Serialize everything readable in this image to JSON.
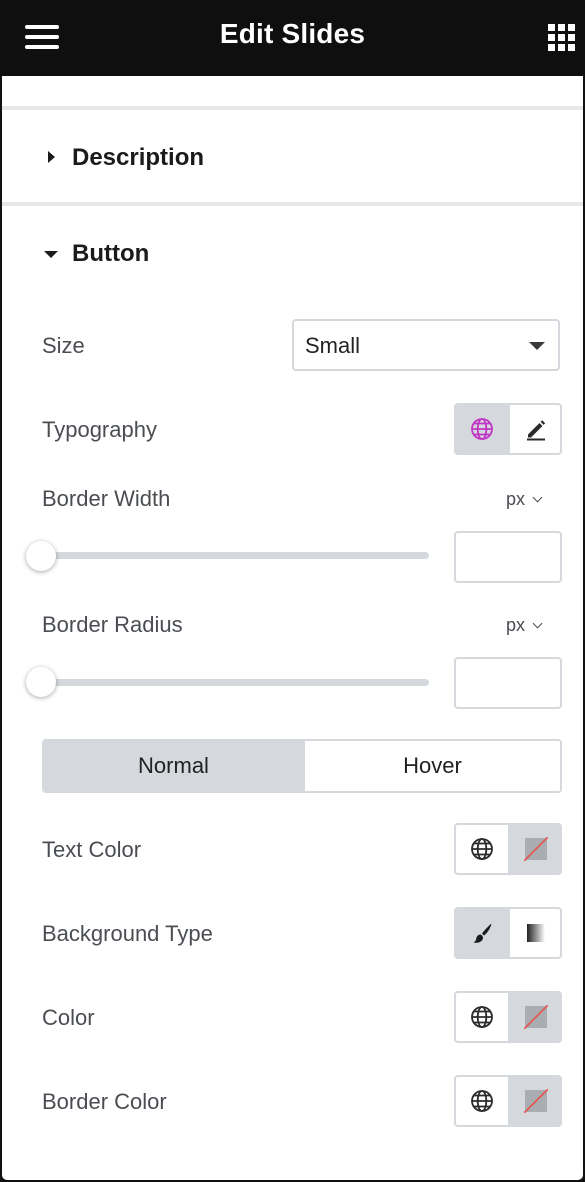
{
  "header": {
    "title": "Edit Slides",
    "menu_icon": "hamburger-menu-icon",
    "widgets_icon": "grid-icon"
  },
  "sections": {
    "description": {
      "label": "Description",
      "expanded": false
    },
    "button": {
      "label": "Button",
      "expanded": true
    }
  },
  "controls": {
    "size": {
      "label": "Size",
      "value": "Small"
    },
    "typography": {
      "label": "Typography",
      "icons": [
        "globe-icon",
        "pencil-icon"
      ],
      "accent": "#c036c5"
    },
    "border_width": {
      "label": "Border Width",
      "unit": "px",
      "value": ""
    },
    "border_radius": {
      "label": "Border Radius",
      "unit": "px",
      "value": ""
    },
    "state_tabs": {
      "items": [
        "Normal",
        "Hover"
      ],
      "active": "Normal"
    },
    "text_color": {
      "label": "Text Color",
      "icons": [
        "globe-icon",
        "no-color-swatch-icon"
      ]
    },
    "background_type": {
      "label": "Background Type",
      "icons": [
        "brush-icon",
        "gradient-icon"
      ],
      "active": "brush-icon"
    },
    "color": {
      "label": "Color",
      "icons": [
        "globe-icon",
        "no-color-swatch-icon"
      ]
    },
    "border_color": {
      "label": "Border Color",
      "icons": [
        "globe-icon",
        "no-color-swatch-icon"
      ]
    }
  },
  "colors": {
    "header_bg": "#0f0f0f",
    "toggle_active_bg": "#d5d8dc",
    "label_text": "#4a4d52",
    "swatch_strike": "#e8534f"
  }
}
